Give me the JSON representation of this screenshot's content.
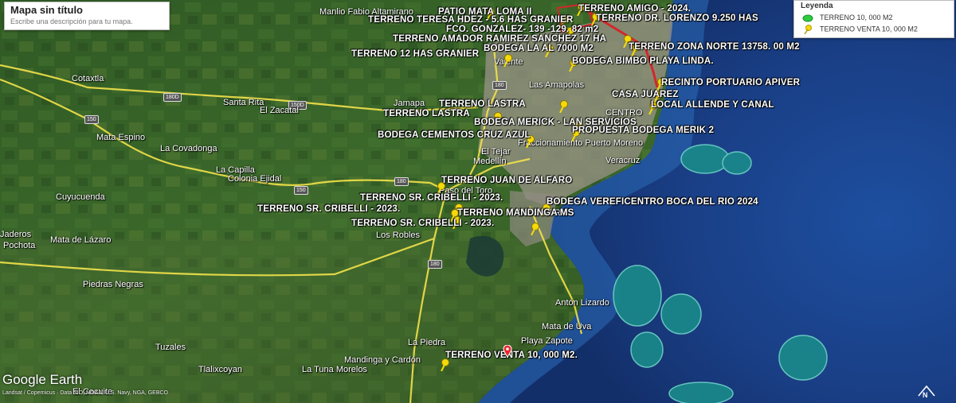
{
  "title_box": {
    "title": "Mapa sin título",
    "description_placeholder": "Escribe una descripción para tu mapa."
  },
  "legend": {
    "title": "Leyenda",
    "items": [
      {
        "label": "TERRENO 10, 000 M2",
        "icon": "green-polygon-icon",
        "color": "#2ecc40"
      },
      {
        "label": "TERRENO VENTA 10, 000 M2",
        "icon": "yellow-pushpin-icon",
        "color": "#f5d90a"
      }
    ]
  },
  "watermark": {
    "logo": "Google Earth",
    "credits": "Landsat / Copernicus · Data SIO, NOAA, U.S. Navy, NGA, GEBCO"
  },
  "places": [
    "Manlio Fabio Altamirano",
    "Cotaxtla",
    "Santa Rita",
    "El Zacatal",
    "Jamapa",
    "Mata Espino",
    "La Covadonga",
    "La Capilla",
    "Colonia Ejidal",
    "Cuyucuenda",
    "Paso del Toro",
    "Medellín",
    "El Tejar",
    "Los Robles",
    "Mata de Lázaro",
    "Piedras Negras",
    "Tuzales",
    "Tlalixcoyan",
    "La Tuna Morelos",
    "Mandinga y Cardón",
    "La Piedra",
    "Antón Lizardo",
    "Mata de Uva",
    "Playa Zapote",
    "El Cocuite",
    "Valente",
    "Las Amapolas",
    "Veracruz",
    "Fraccionamiento Puerto Moreno",
    "CENTRO",
    "Boca del Río",
    "Pochota",
    "Jaderos"
  ],
  "road_labels": [
    "180D",
    "150D",
    "150",
    "180",
    "180",
    "150",
    "180"
  ],
  "pins": [
    "PATIO MATA LOMA II",
    "TERRENO AMIGO - 2024.",
    "TERRENO TERESA HDEZ - 5.6 HAS GRANIER",
    "TERRENO DR. LORENZO 9.250 HAS",
    "FCO. GONZALEZ- 139 -129. 82 m2",
    "TERRENO AMADOR RAMIREZ SANCHEZ 17 HA",
    "BODEGA LA AL 7000 M2",
    "TERRENO ZONA NORTE 13758. 00 M2",
    "TERRENO 12 HAS GRANIER",
    "BODEGA BIMBO PLAYA LINDA.",
    "RECINTO PORTUARIO APIVER",
    "CASA JUAREZ",
    "LOCAL ALLENDE Y CANAL",
    "TERRENO LASTRA",
    "TERRENO LASTRA",
    "BODEGA MERICK - LAN SERVICIOS",
    "PROPUESTA BODEGA MERIK 2",
    "BODEGA CEMENTOS CRUZ AZUL",
    "TERRENO JUAN DE ALFARO",
    "TERRENO SR. CRIBELLI - 2023.",
    "BODEGA VEREFICENTRO BOCA DEL RIO 2024",
    "TERRENO SR. CRIBELLI - 2023.",
    "TERRENO MANDINGA MS",
    "TERRENO SR. CRIBELLI - 2023.",
    "TERRENO VENTA 10, 000 M2."
  ]
}
